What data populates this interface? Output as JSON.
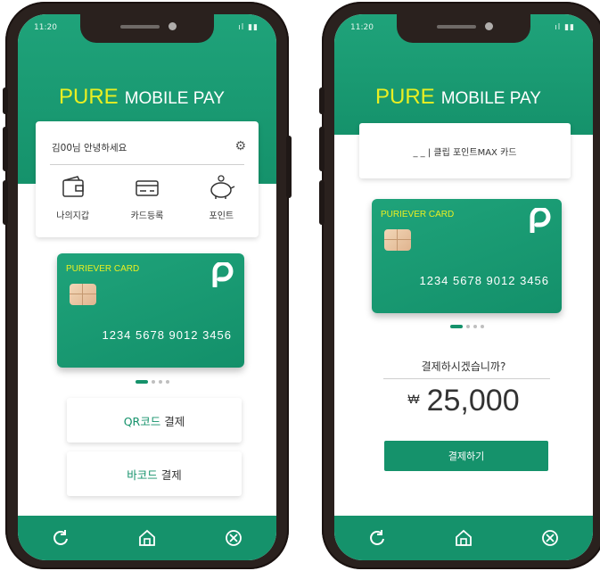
{
  "left_phone": {
    "status_time": "11:20",
    "status_signal": "ıl ▮▮",
    "brand_pure": "PURE",
    "brand_rest": "MOBILE PAY",
    "welcome_text": "김00님 안녕하세요",
    "menu": [
      {
        "label": "나의지갑",
        "icon": "wallet-icon"
      },
      {
        "label": "카드등록",
        "icon": "card-register-icon"
      },
      {
        "label": "포인트",
        "icon": "piggy-bank-icon"
      }
    ],
    "card": {
      "name": "PURIEVER CARD",
      "number": "1234  5678  9012  3456"
    },
    "qr_button": {
      "accent": "QR코드",
      "label": "결제"
    },
    "barcode_button": {
      "accent": "바코드",
      "label": "결제"
    },
    "nav": [
      "refresh-icon",
      "home-icon",
      "close-circle-icon"
    ]
  },
  "right_phone": {
    "status_time": "11:20",
    "status_signal": "ıl ▮▮",
    "brand_pure": "PURE",
    "brand_rest": "MOBILE PAY",
    "card_label": "_ _ | 클립 포인트MAX 카드",
    "card": {
      "name": "PURIEVER CARD",
      "number": "1234  5678  9012  3456"
    },
    "question": "결제하시겠습니까?",
    "currency": "₩",
    "amount": "25,000",
    "confirm_button": "결제하기",
    "nav": [
      "refresh-icon",
      "home-icon",
      "close-circle-icon"
    ]
  },
  "colors": {
    "primary": "#15926b",
    "accent_yellow": "#e9ef22",
    "frame": "#2a211e"
  }
}
